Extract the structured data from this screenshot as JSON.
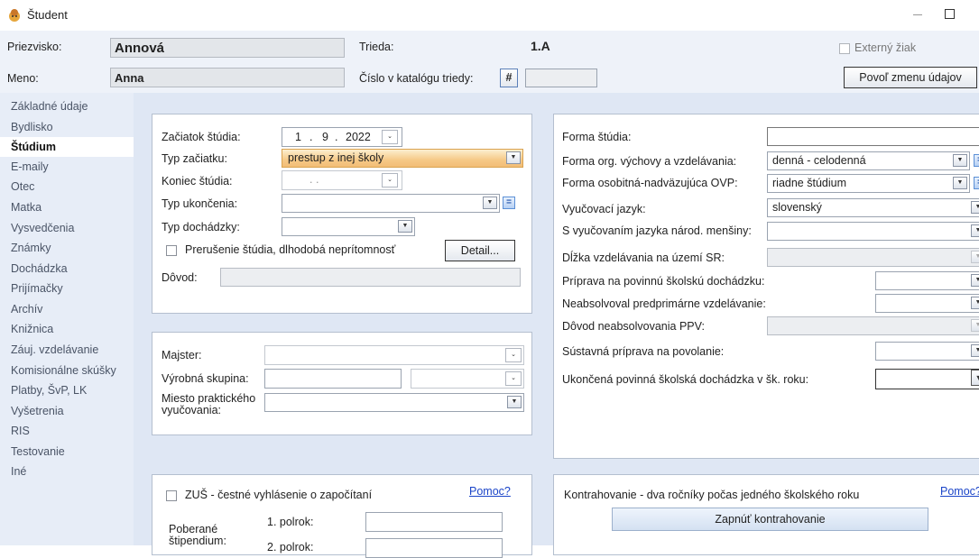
{
  "window": {
    "title": "Študent"
  },
  "header": {
    "surname_label": "Priezvisko:",
    "surname": "Annová",
    "name_label": "Meno:",
    "name": "Anna",
    "class_label": "Trieda:",
    "class_value": "1.A",
    "catalog_label": "Číslo v katalógu triedy:",
    "catalog_hash": "#",
    "catalog_value": "",
    "external_label": "Externý žiak",
    "allow_change_button": "Povoľ zmenu údajov"
  },
  "sidebar": {
    "items": [
      {
        "label": "Základné údaje"
      },
      {
        "label": "Bydlisko"
      },
      {
        "label": "Štúdium"
      },
      {
        "label": "E-maily"
      },
      {
        "label": "Otec"
      },
      {
        "label": "Matka"
      },
      {
        "label": "Vysvedčenia"
      },
      {
        "label": "Známky"
      },
      {
        "label": "Dochádzka"
      },
      {
        "label": "Prijímačky"
      },
      {
        "label": "Archív"
      },
      {
        "label": "Knižnica"
      },
      {
        "label": "Záuj. vzdelávanie"
      },
      {
        "label": "Komisionálne skúšky"
      },
      {
        "label": "Platby, ŠvP, LK"
      },
      {
        "label": "Vyšetrenia"
      },
      {
        "label": "RIS"
      },
      {
        "label": "Testovanie"
      },
      {
        "label": "Iné"
      }
    ]
  },
  "study": {
    "start_label": "Začiatok štúdia:",
    "start_day": "1",
    "start_month": "9",
    "start_year": "2022",
    "start_type_label": "Typ začiatku:",
    "start_type": "prestup z inej školy",
    "end_label": "Koniec štúdia:",
    "end_value": ".   .",
    "end_type_label": "Typ ukončenia:",
    "attendance_label": "Typ dochádzky:",
    "interruption_label": "Prerušenie štúdia, dlhodobá neprítomnosť",
    "detail_button": "Detail...",
    "reason_label": "Dôvod:"
  },
  "practice": {
    "master_label": "Majster:",
    "group_label": "Výrobná skupina:",
    "place_label_1": "Miesto praktického",
    "place_label_2": "vyučovania:"
  },
  "zus": {
    "declaration_label": "ZUŠ - čestné vyhlásenie o započítaní",
    "help_link": "Pomoc?",
    "scholarship_label_1": "Poberané",
    "scholarship_label_2": "štipendium:",
    "half1_label": "1. polrok:",
    "half2_label": "2. polrok:"
  },
  "form": {
    "form_label": "Forma štúdia:",
    "form_value": "",
    "org_label": "Forma org. výchovy a vzdelávania:",
    "org_value": "denná - celodenná",
    "special_label": "Forma osobitná-nadväzujúca OVP:",
    "special_value": "riadne štúdium",
    "language_label": "Vyučovací jazyk:",
    "language_value": "slovenský",
    "minority_label": "S vyučovaním jazyka národ. menšiny:",
    "duration_label": "Dĺžka vzdelávania na území SR:",
    "prep_label": "Príprava na povinnú školskú dochádzku:",
    "preprimary_label": "Neabsolvoval predprimárne vzdelávanie:",
    "ppv_reason_label": "Dôvod neabsolvovania PPV:",
    "system_prep_label": "Sústavná príprava na povolanie:",
    "completed_label": "Ukončená povinná školská dochádzka v šk. roku:"
  },
  "contract": {
    "label": "Kontrahovanie - dva ročníky počas jedného školského roku",
    "help_link": "Pomoc?",
    "button": "Zapnúť kontrahovanie"
  }
}
